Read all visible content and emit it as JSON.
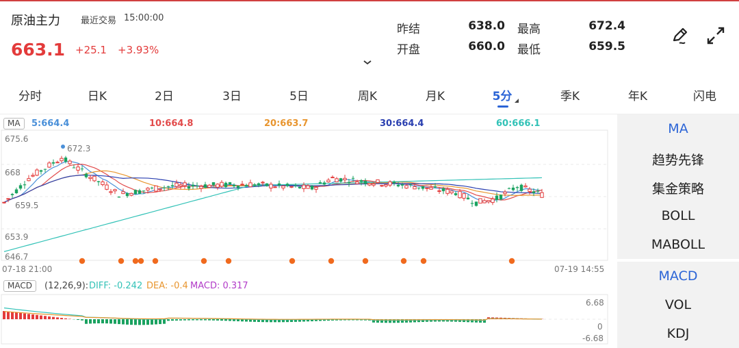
{
  "header": {
    "name": "原油主力",
    "label": "最近交易",
    "time": "15:00:00",
    "price": "663.1",
    "change": "+25.1",
    "change_pct": "+3.93%",
    "collapse_icon": "chevron-down-icon",
    "edit_icon": "pen-icon",
    "expand_icon": "expand-icon"
  },
  "stats": [
    {
      "label": "昨结",
      "value": "638.0"
    },
    {
      "label": "开盘",
      "value": "660.0"
    },
    {
      "label": "最高",
      "value": "672.4"
    },
    {
      "label": "最低",
      "value": "659.5"
    }
  ],
  "tabs": [
    "分时",
    "日K",
    "2日",
    "3日",
    "5日",
    "周K",
    "月K",
    "5分",
    "季K",
    "年K",
    "闪电"
  ],
  "active_tab": "5分",
  "ma_legend": {
    "button": "MA",
    "items": [
      {
        "text": "5:664.4",
        "color": "#4a90d9"
      },
      {
        "text": "10:664.8",
        "color": "#e24b4b"
      },
      {
        "text": "20:663.7",
        "color": "#e8952e"
      },
      {
        "text": "30:664.4",
        "color": "#2a3fb0"
      },
      {
        "text": "60:666.1",
        "color": "#32c2b7"
      }
    ]
  },
  "price_axis": {
    "top": "675.6",
    "mid": "672.3",
    "low": "653.9",
    "bottom": "646.7",
    "partial_1": "668",
    "partial_2": "659.5"
  },
  "time_axis": {
    "start": "07-18 21:00",
    "end": "07-19 14:55"
  },
  "macd_legend": {
    "button": "MACD",
    "params": "(12,26,9):",
    "diff": "DIFF: -0.242",
    "dea": "DEA: -0.4",
    "macd": "MACD: 0.317",
    "diff_color": "#32c2b7",
    "dea_color": "#e8952e",
    "macd_color": "#b23bc8"
  },
  "macd_axis": {
    "top": "6.68",
    "zero": "0",
    "bottom": "-6.68"
  },
  "indicator_panel_main": [
    "MA",
    "趋势先锋",
    "集金策略",
    "BOLL",
    "MABOLL"
  ],
  "indicator_panel_sub": [
    "MACD",
    "VOL",
    "KDJ"
  ],
  "colors": {
    "up": "#e33b3b",
    "down": "#1aa260",
    "accent": "#2b64d6",
    "signal_dot": "#f06a1e"
  }
}
